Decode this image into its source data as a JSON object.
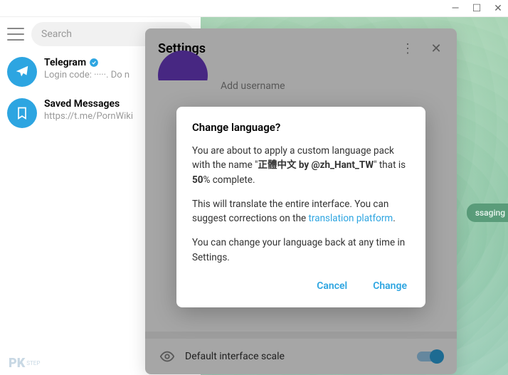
{
  "titlebar": {
    "min": "—",
    "max": "☐",
    "close": "✕"
  },
  "search": {
    "placeholder": "Search"
  },
  "chats": [
    {
      "name": "Telegram",
      "msg": "Login code: ·····. Do n"
    },
    {
      "name": "Saved Messages",
      "msg": "https://t.me/PornWiki"
    }
  ],
  "right": {
    "badge": "ssaging"
  },
  "settings": {
    "title": "Settings",
    "add_username": "Add username",
    "scale_label": "Default interface scale"
  },
  "modal": {
    "title": "Change language?",
    "p1a": "You are about to apply a custom language pack with the name \"",
    "p1b": "正體中文 by @zh_Hant_TW",
    "p1c": "\" that is ",
    "p1pct": "50",
    "p1d": "% complete.",
    "p2a": "This will translate the entire interface. You can suggest corrections on the ",
    "p2link": "translation platform",
    "p2b": ".",
    "p3": "You can change your language back at any time in Settings.",
    "cancel": "Cancel",
    "change": "Change"
  },
  "watermark": {
    "main": "PK",
    "sub": "STEP"
  }
}
